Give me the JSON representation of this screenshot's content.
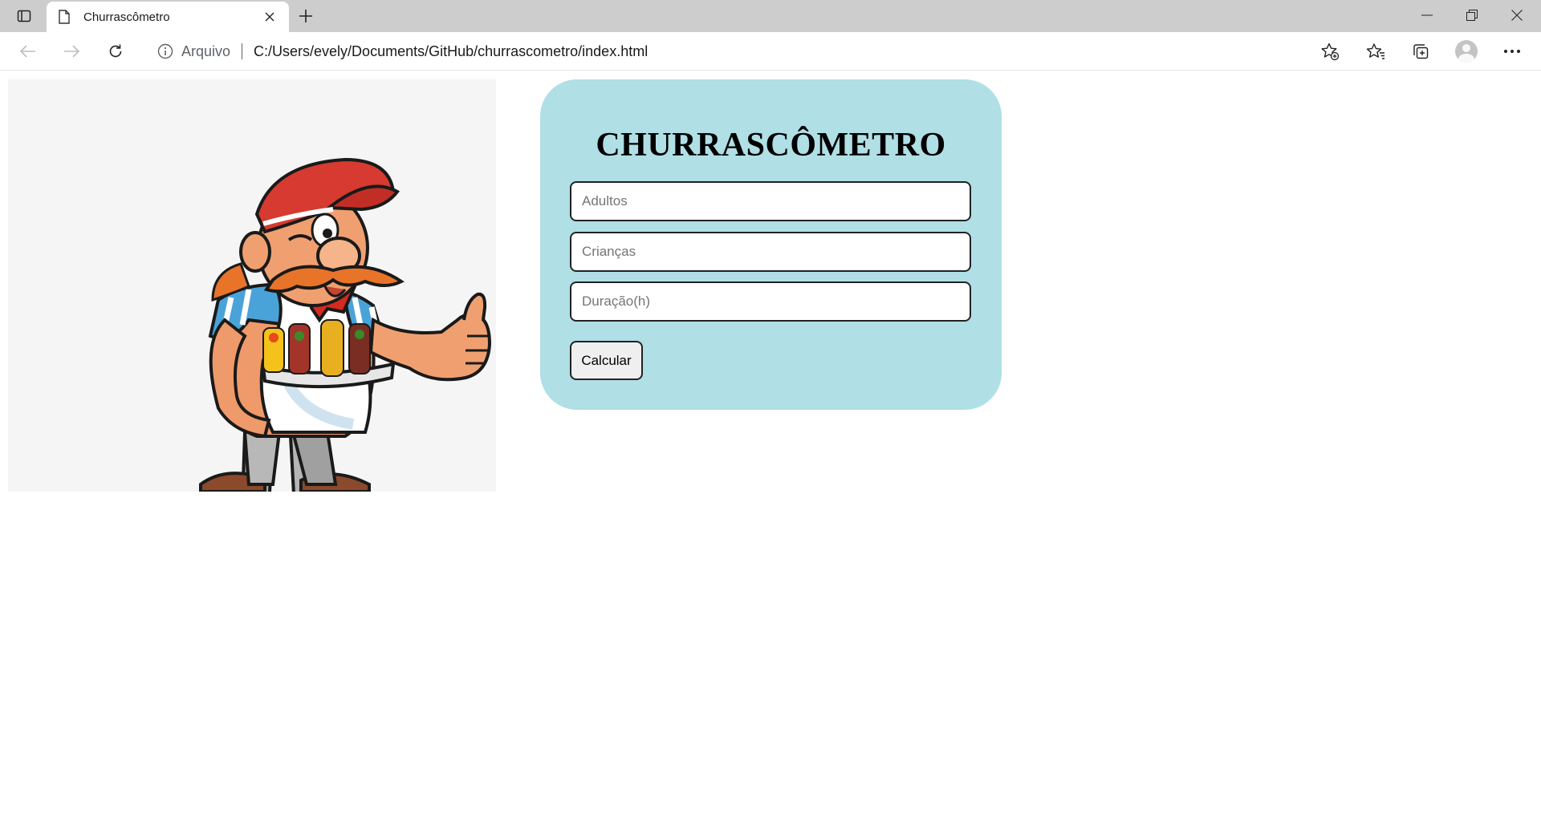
{
  "browser": {
    "tab": {
      "title": "Churrascômetro"
    },
    "address_bar": {
      "scheme_label": "Arquivo",
      "url": "C:/Users/evely/Documents/GitHub/churrascometro/index.html"
    }
  },
  "page": {
    "title": "CHURRASCÔMETRO",
    "inputs": {
      "adultos_placeholder": "Adultos",
      "criancas_placeholder": "Crianças",
      "duracao_placeholder": "Duração(h)"
    },
    "calculate_button": "Calcular",
    "card_color": "#b0dfe6",
    "hero_image": "cartoon-barbecue-chef-with-skewers"
  }
}
